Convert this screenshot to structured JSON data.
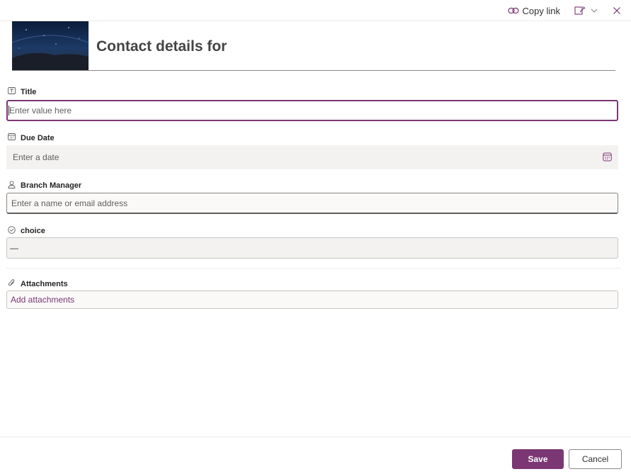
{
  "topbar": {
    "copy_link_label": "Copy link",
    "link_icon": "link-icon",
    "edit_icon": "edit-form-icon",
    "chevron_icon": "chevron-down-icon",
    "close_icon": "close-icon"
  },
  "header": {
    "title": "Contact details for",
    "thumbnail": "night-sky-image"
  },
  "fields": {
    "title": {
      "label": "Title",
      "icon": "text-field-icon",
      "placeholder": "Enter value here"
    },
    "due_date": {
      "label": "Due Date",
      "icon": "calendar-icon",
      "placeholder": "Enter a date"
    },
    "branch_manager": {
      "label": "Branch Manager",
      "icon": "person-icon",
      "placeholder": "Enter a name or email address"
    },
    "choice": {
      "label": "choice",
      "icon": "check-circle-icon",
      "value": "—"
    },
    "attachments": {
      "label": "Attachments",
      "icon": "paperclip-icon",
      "link_text": "Add attachments"
    }
  },
  "footer": {
    "save_label": "Save",
    "cancel_label": "Cancel"
  },
  "colors": {
    "accent": "#7a3773",
    "text": "#323130",
    "field_bg": "#f4f2f0"
  }
}
